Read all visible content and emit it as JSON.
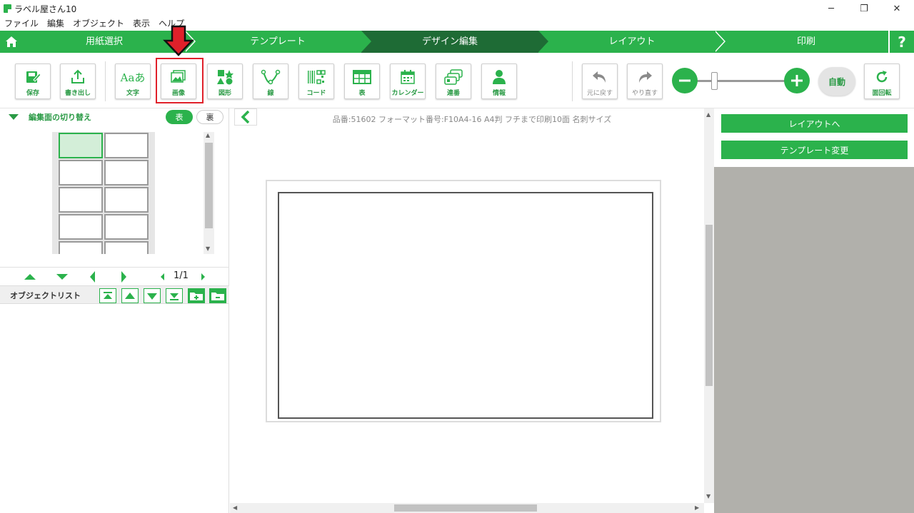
{
  "window": {
    "title": "ラベル屋さん10",
    "minimize": "─",
    "restore": "❐",
    "close": "✕"
  },
  "menu": [
    "ファイル",
    "編集",
    "オブジェクト",
    "表示",
    "ヘルプ"
  ],
  "steps": [
    {
      "label": "用紙選択",
      "active": false
    },
    {
      "label": "テンプレート",
      "active": false
    },
    {
      "label": "デザイン編集",
      "active": true
    },
    {
      "label": "レイアウト",
      "active": false
    },
    {
      "label": "印刷",
      "active": false
    }
  ],
  "help_label": "?",
  "toolbar": {
    "save": "保存",
    "export": "書き出し",
    "text": "文字",
    "text_glyph": "Aaあ",
    "image": "画像",
    "shape": "図形",
    "line": "線",
    "code": "コード",
    "table": "表",
    "calendar": "カレンダー",
    "serial": "連番",
    "info": "情報",
    "undo": "元に戻す",
    "redo": "やり直す",
    "auto": "自動",
    "rotate": "面回転"
  },
  "left_panel": {
    "edit_face_label": "編集面の切り替え",
    "front": "表",
    "back": "裏",
    "page_indicator": "1/1",
    "object_list_label": "オブジェクトリスト"
  },
  "canvas": {
    "product_info": "品番:51602 フォーマット番号:F10A4-16 A4判 フチまで印刷10面 名刺サイズ"
  },
  "right_panel": {
    "to_layout": "レイアウトへ",
    "change_template": "テンプレート変更"
  },
  "colors": {
    "accent": "#2bb24c",
    "active_step": "#1e6b35",
    "highlight": "#e0202a",
    "right_panel_bg": "#b1b0ab"
  }
}
